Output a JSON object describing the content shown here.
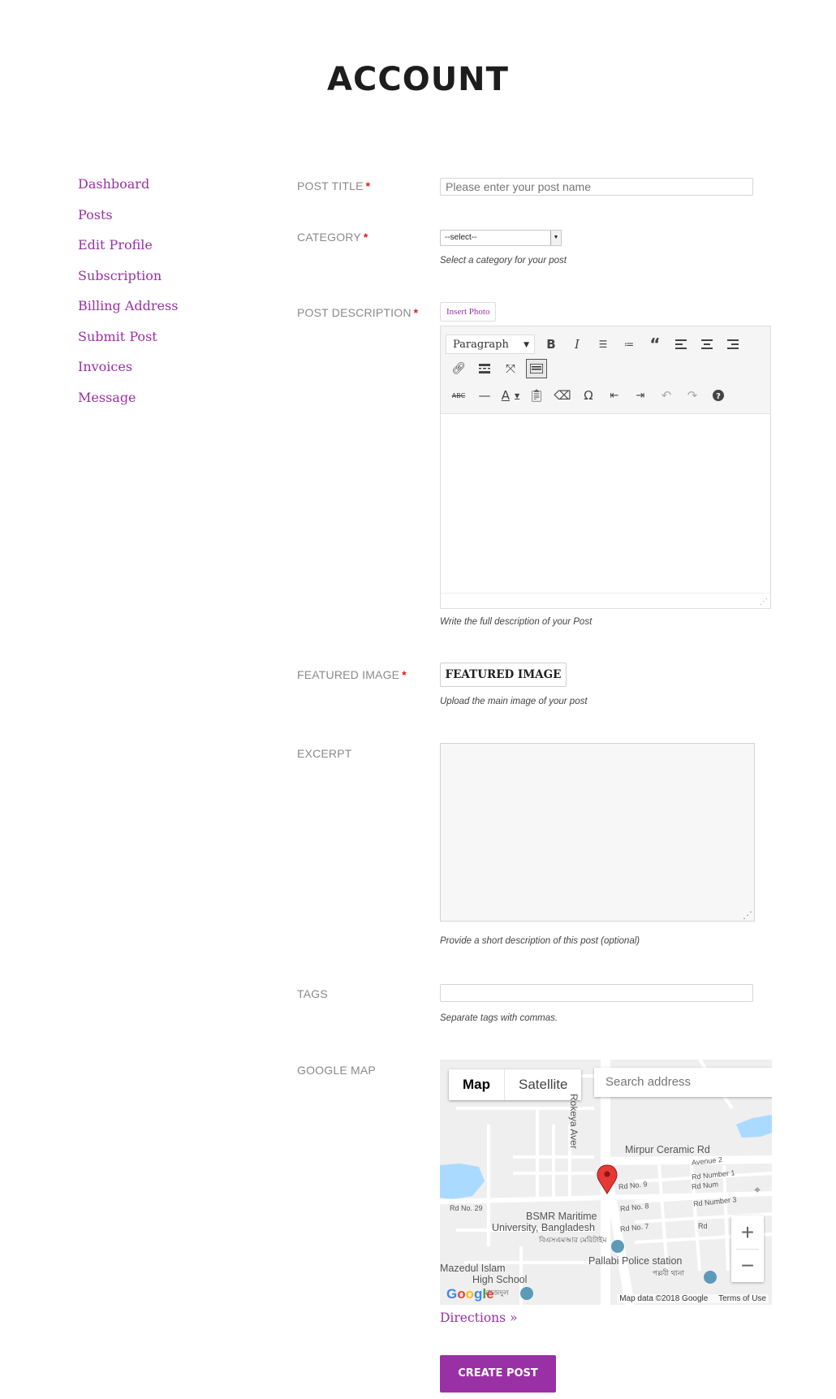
{
  "page": {
    "title": "ACCOUNT"
  },
  "sidebar": {
    "items": [
      {
        "label": "Dashboard"
      },
      {
        "label": "Posts"
      },
      {
        "label": "Edit Profile"
      },
      {
        "label": "Subscription"
      },
      {
        "label": "Billing Address"
      },
      {
        "label": "Submit Post"
      },
      {
        "label": "Invoices"
      },
      {
        "label": "Message"
      }
    ]
  },
  "form": {
    "required_mark": "*",
    "post_title": {
      "label": "POST TITLE",
      "placeholder": "Please enter your post name"
    },
    "category": {
      "label": "CATEGORY",
      "selected": "--select--",
      "hint": "Select a category for your post"
    },
    "description": {
      "label": "POST DESCRIPTION",
      "insert_photo": "Insert Photo",
      "format_select": "Paragraph",
      "hint": "Write the full description of your Post",
      "toolbar_icons": {
        "row1": [
          "bold-icon",
          "italic-icon",
          "bullet-list-icon",
          "numbered-list-icon",
          "blockquote-icon",
          "align-left-icon",
          "align-center-icon",
          "align-right-icon"
        ],
        "row2": [
          "link-icon",
          "read-more-icon",
          "fullscreen-icon",
          "toolbar-toggle-icon"
        ],
        "row3": [
          "strikethrough-icon",
          "horizontal-line-icon",
          "text-color-icon",
          "paste-text-icon",
          "clear-format-icon",
          "special-char-icon",
          "outdent-icon",
          "indent-icon",
          "undo-icon",
          "redo-icon",
          "help-icon"
        ]
      }
    },
    "featured_image": {
      "label": "FEATURED IMAGE",
      "button": "FEATURED IMAGE",
      "hint": "Upload the main image of your post"
    },
    "excerpt": {
      "label": "EXCERPT",
      "hint": "Provide a short description of this post (optional)"
    },
    "tags": {
      "label": "TAGS",
      "hint": "Separate tags with commas."
    },
    "google_map": {
      "label": "GOOGLE MAP",
      "map_type_map": "Map",
      "map_type_satellite": "Satellite",
      "search_placeholder": "Search address",
      "labels": {
        "road_main": "Mirpur Ceramic Rd",
        "road_vertical": "Rokeya Aver",
        "avenue": "Avenue 2",
        "rd_number1": "Rd Number 1",
        "rd_num": "Rd Num",
        "rd_number3": "Rd Number 3",
        "rd_no9": "Rd No. 9",
        "rd_no8": "Rd No. 8",
        "rd_no7": "Rd No. 7",
        "rd_no29": "Rd No. 29",
        "university_1": "BSMR Maritime",
        "university_2": "University, Bangladesh",
        "university_bn": "বিএসএমআর মেরিটাইম",
        "police": "Pallabi Police station",
        "police_bn": "পল্লবী থানা",
        "school_1": "Mazedul Islam",
        "school_2": "High School",
        "school_bn": "মাজেদুল",
        "rd_abbrev": "Rd"
      },
      "logo": "Google",
      "attribution": "Map data ©2018 Google",
      "terms": "Terms of Use",
      "zoom_in": "+",
      "zoom_out": "−"
    },
    "directions": "Directions »",
    "submit": "CREATE POST"
  }
}
